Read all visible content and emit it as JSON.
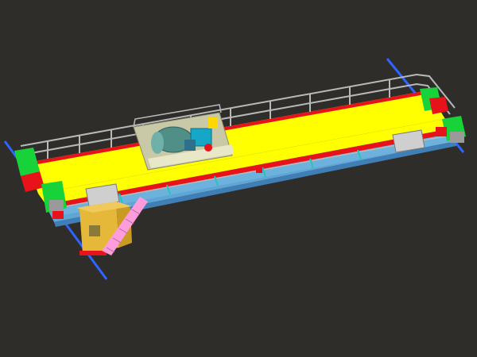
{
  "scene": {
    "subject": "double-girder-overhead-crane",
    "colors": {
      "background": "#2e2d2a",
      "girder_deck": "#ffff00",
      "girder_side": "#5fa6d6",
      "girder_bottom": "#3f7fb6",
      "girder_edge_red": "#e8121b",
      "end_carriage_green": "#18d23a",
      "rail_line": "#2f64ff",
      "handrail": "#b9b9b9",
      "cab": "#e5b83a",
      "ladder": "#ff9cdc",
      "trolley_frame": "#c9c9a8",
      "hoist_drum": "#4f8f88",
      "hoist_motor": "#16a7c6",
      "control_cabinet": "#cfcfcf"
    }
  }
}
